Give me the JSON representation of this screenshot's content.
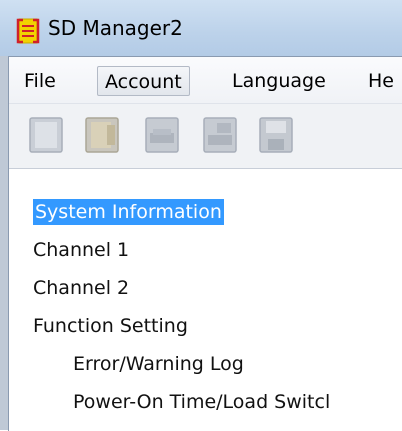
{
  "window": {
    "title": "SD Manager2",
    "icon": "sd-manager-app-icon"
  },
  "menu": {
    "items": [
      {
        "label": "File"
      },
      {
        "label": "Account"
      },
      {
        "label": "Language"
      },
      {
        "label": "He"
      }
    ],
    "active_index": 1
  },
  "toolbar": {
    "buttons": [
      {
        "name": "new-icon"
      },
      {
        "name": "open-icon"
      },
      {
        "name": "device-icon"
      },
      {
        "name": "device-transfer-icon"
      },
      {
        "name": "save-icon"
      }
    ],
    "state": "disabled"
  },
  "tree": {
    "items": [
      {
        "label": "System Information",
        "selected": true,
        "level": 0
      },
      {
        "label": "Channel 1",
        "selected": false,
        "level": 0
      },
      {
        "label": "Channel 2",
        "selected": false,
        "level": 0
      },
      {
        "label": "Function Setting",
        "selected": false,
        "level": 0
      },
      {
        "label": "Error/Warning Log",
        "selected": false,
        "level": 1
      },
      {
        "label": "Power-On Time/Load Switcl",
        "selected": false,
        "level": 1
      }
    ]
  },
  "colors": {
    "selection": "#3399ff",
    "app_icon": "#e8c200",
    "app_icon_bracket": "#d0202a"
  }
}
